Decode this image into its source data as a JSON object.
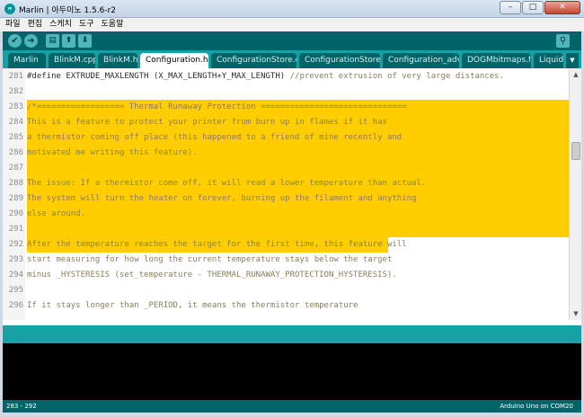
{
  "window": {
    "title": "Marlin | 아두이노 1.5.6-r2",
    "app_icon": "arduino-icon",
    "buttons": {
      "minimize": "–",
      "maximize": "□",
      "close": "✕"
    }
  },
  "menu": [
    "파일",
    "편집",
    "스케치",
    "도구",
    "도움말"
  ],
  "toolbar": {
    "verify_icon": "✔",
    "upload_icon": "➜",
    "new_icon": "▤",
    "open_icon": "⬆",
    "save_icon": "⬇",
    "serial_monitor_icon": "⚲"
  },
  "tabs": [
    {
      "label": "Marlin"
    },
    {
      "label": "BlinkM.cpp"
    },
    {
      "label": "BlinkM.h"
    },
    {
      "label": "Configuration.h §",
      "active": true
    },
    {
      "label": "ConfigurationStore.cpp"
    },
    {
      "label": "ConfigurationStore.h"
    },
    {
      "label": "Configuration_adv.h"
    },
    {
      "label": "DOGMbitmaps.h"
    },
    {
      "label": "LiquidCrystalRus"
    }
  ],
  "tab_menu_icon": "▼",
  "editor": {
    "lines": [
      {
        "num": "281",
        "code": "#define EXTRUDE_MAXLENGTH (X_MAX_LENGTH+Y_MAX_LENGTH)",
        "comment": " //prevent extrusion of very large distances.",
        "hl": "none"
      },
      {
        "num": "282",
        "code": "",
        "comment": "",
        "hl": "none"
      },
      {
        "num": "283",
        "code": "",
        "comment": "/*================== Thermal Runaway Protection ==============================",
        "hl": "full"
      },
      {
        "num": "284",
        "code": "",
        "comment": "This is a feature to protect your printer from burn up in flames if it has",
        "hl": "full"
      },
      {
        "num": "285",
        "code": "",
        "comment": "a thermistor coming off place (this happened to a friend of mine recently and",
        "hl": "full"
      },
      {
        "num": "286",
        "code": "",
        "comment": "motivated me writing this feature).",
        "hl": "full"
      },
      {
        "num": "287",
        "code": "",
        "comment": "",
        "hl": "full"
      },
      {
        "num": "288",
        "code": "",
        "comment": "The issue: If a thermistor come off, it will read a lower temperature than actual.",
        "hl": "full"
      },
      {
        "num": "289",
        "code": "",
        "comment": "The system will turn the heater on forever, burning up the filament and anything",
        "hl": "full"
      },
      {
        "num": "290",
        "code": "",
        "comment": "else around.",
        "hl": "full"
      },
      {
        "num": "291",
        "code": "",
        "comment": "",
        "hl": "full"
      },
      {
        "num": "292",
        "code": "",
        "comment": "After the temperature reaches the target for the first time, this feature will",
        "hl": "partial"
      },
      {
        "num": "293",
        "code": "",
        "comment": "start measuring for how long the current temperature stays below the target",
        "hl": "none"
      },
      {
        "num": "294",
        "code": "",
        "comment": "minus _HYSTERESIS (set_temperature - THERMAL_RUNAWAY_PROTECTION_HYSTERESIS).",
        "hl": "none"
      },
      {
        "num": "295",
        "code": "",
        "comment": "",
        "hl": "none"
      },
      {
        "num": "296",
        "code": "",
        "comment": "If it stays longer than _PERIOD, it means the thermistor temperature",
        "hl": "none"
      }
    ]
  },
  "scrollbar": {
    "up_icon": "▲",
    "down_icon": "▼"
  },
  "footer": {
    "line_range": "283 - 292",
    "board_info": "Arduino Uno on COM20"
  },
  "colors": {
    "highlight": "#ffcd00",
    "toolbar": "#006468",
    "tabbar": "#17a1a5"
  }
}
